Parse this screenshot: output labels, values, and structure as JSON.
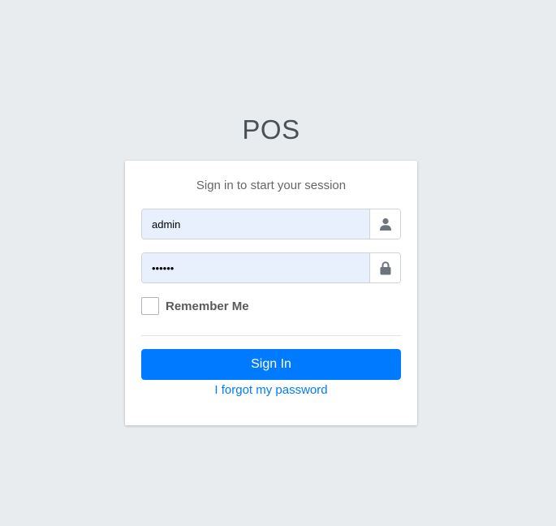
{
  "logo": {
    "text": "POS"
  },
  "card": {
    "message": "Sign in to start your session",
    "username": {
      "value": "admin",
      "icon": "user-icon"
    },
    "password": {
      "value": "••••••",
      "icon": "lock-icon"
    },
    "remember_label": "Remember Me",
    "sign_in_label": "Sign In",
    "forgot_label": "I forgot my password"
  },
  "colors": {
    "background": "#e9ecef",
    "primary": "#007bff",
    "input_autofill": "#e8f0fe"
  }
}
